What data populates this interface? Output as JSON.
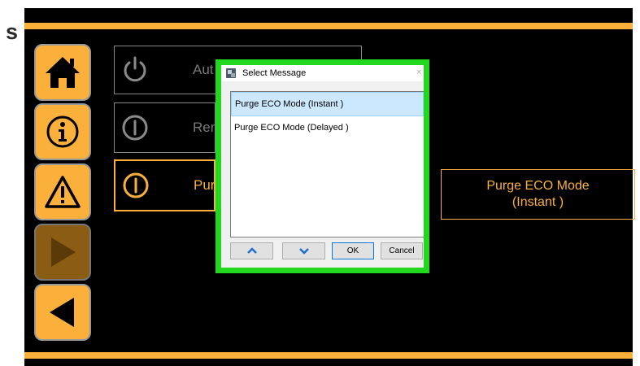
{
  "page_edge_text": "s",
  "colors": {
    "accent": "#fbb03b",
    "screen_bg": "#000000",
    "highlight_frame": "#22d81e",
    "list_selection": "#cce8ff"
  },
  "sidebar": {
    "buttons": [
      {
        "name": "home",
        "icon": "home-icon"
      },
      {
        "name": "info",
        "icon": "info-icon"
      },
      {
        "name": "warning",
        "icon": "warning-icon"
      },
      {
        "name": "play",
        "icon": "play-icon",
        "state": "disabled"
      },
      {
        "name": "back",
        "icon": "back-arrow-icon"
      }
    ]
  },
  "rows": [
    {
      "label": "Aut",
      "icon": "power-icon",
      "selected": false
    },
    {
      "label": "Ren",
      "icon": "standby-icon",
      "selected": false
    },
    {
      "label": "Purg",
      "icon": "standby-icon",
      "selected": true
    }
  ],
  "detail": {
    "line1": "Purge ECO Mode",
    "line2": "(Instant )"
  },
  "dialog": {
    "title": "Select Message",
    "close": "×",
    "items": [
      {
        "label": "Purge ECO Mode  (Instant )",
        "selected": true
      },
      {
        "label": "Purge ECO Mode  (Delayed )",
        "selected": false
      }
    ],
    "buttons": {
      "up": "up-arrow-icon",
      "down": "down-arrow-icon",
      "ok": "OK",
      "cancel": "Cancel"
    }
  }
}
